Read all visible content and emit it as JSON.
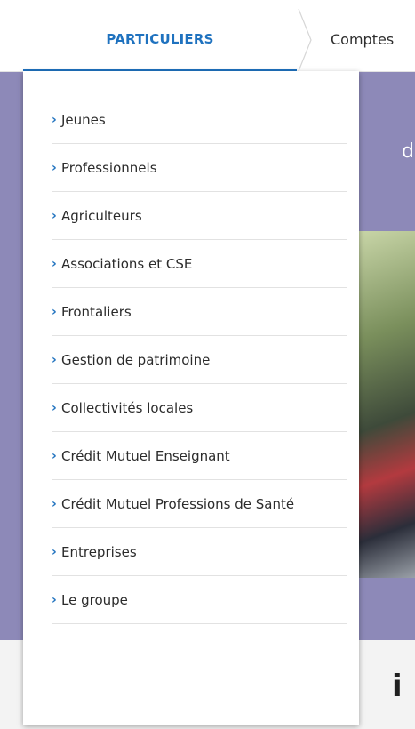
{
  "tabs": {
    "active_label": "PARTICULIERS",
    "next_label": "Comptes"
  },
  "menu": {
    "chevron": "›",
    "items": [
      {
        "label": "Jeunes"
      },
      {
        "label": "Professionnels"
      },
      {
        "label": "Agriculteurs"
      },
      {
        "label": "Associations et CSE"
      },
      {
        "label": "Frontaliers"
      },
      {
        "label": "Gestion de patrimoine"
      },
      {
        "label": "Collectivités locales"
      },
      {
        "label": "Crédit Mutuel Enseignant"
      },
      {
        "label": "Crédit Mutuel Professions de Santé"
      },
      {
        "label": "Entreprises"
      },
      {
        "label": "Le groupe"
      }
    ]
  },
  "background": {
    "heading_fragment": "d",
    "bottom_fragment": "i"
  },
  "colors": {
    "accent": "#1f72bf",
    "band": "#8d89b8",
    "text": "#2b2b2b"
  }
}
